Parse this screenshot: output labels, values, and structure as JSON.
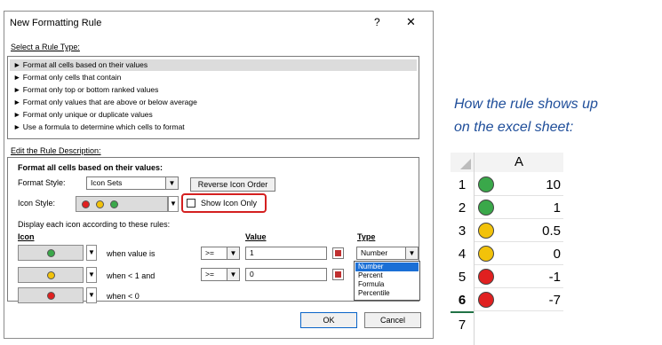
{
  "dialog": {
    "title": "New Formatting Rule",
    "help": "?",
    "close": "✕",
    "select_rule_type_label": "Select a Rule Type:",
    "rule_types": [
      "► Format all cells based on their values",
      "► Format only cells that contain",
      "► Format only top or bottom ranked values",
      "► Format only values that are above or below average",
      "► Format only unique or duplicate values",
      "► Use a formula to determine which cells to format"
    ],
    "edit_description_label": "Edit the Rule Description:",
    "format_all_label": "Format all cells based on their values:",
    "format_style_label": "Format Style:",
    "format_style_value": "Icon Sets",
    "reverse_icon_order": "Reverse Icon Order",
    "icon_style_label": "Icon Style:",
    "show_icon_only": "Show Icon Only",
    "display_each_label": "Display each icon according to these rules:",
    "col_icon": "Icon",
    "col_value": "Value",
    "col_type": "Type",
    "rules": [
      {
        "icon": "green-circle",
        "condition": "when value is",
        "operator": ">=",
        "value": "1",
        "type": "Number"
      },
      {
        "icon": "yellow-circle",
        "condition": "when < 1 and",
        "operator": ">=",
        "value": "0",
        "type": ""
      },
      {
        "icon": "red-circle",
        "condition": "when < 0",
        "operator": "",
        "value": "",
        "type": ""
      }
    ],
    "type_options": [
      "Number",
      "Percent",
      "Formula",
      "Percentile"
    ],
    "ok": "OK",
    "cancel": "Cancel"
  },
  "caption": {
    "line1": "How the rule shows up",
    "line2": "on the excel sheet:"
  },
  "sheet": {
    "column": "A",
    "rows": [
      {
        "num": "1",
        "icon": "green-circle",
        "value": "10"
      },
      {
        "num": "2",
        "icon": "green-circle",
        "value": "1"
      },
      {
        "num": "3",
        "icon": "yellow-circle",
        "value": "0.5"
      },
      {
        "num": "4",
        "icon": "yellow-circle",
        "value": "0"
      },
      {
        "num": "5",
        "icon": "red-circle",
        "value": "-1"
      },
      {
        "num": "6",
        "icon": "red-circle",
        "value": "-7"
      },
      {
        "num": "7",
        "icon": "",
        "value": ""
      }
    ],
    "active_row": "6"
  },
  "colors": {
    "green": "#3aa84a",
    "yellow": "#f2c20a",
    "red": "#e02020",
    "caption": "#1f4e9a",
    "selection": "#1a6fd6"
  }
}
